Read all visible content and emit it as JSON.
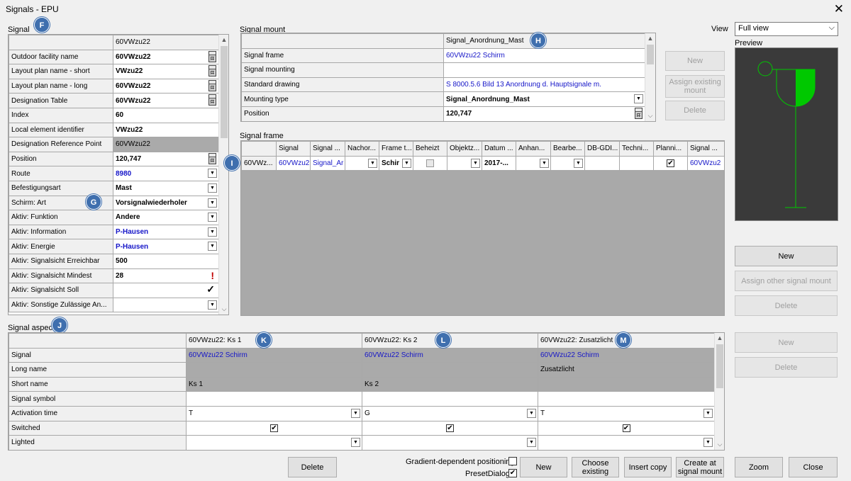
{
  "window": {
    "title": "Signals - EPU",
    "close": "✕"
  },
  "badges": {
    "F": "F",
    "G": "G",
    "H": "H",
    "I": "I",
    "J": "J",
    "K": "K",
    "L": "L",
    "M": "M"
  },
  "signal": {
    "group_label": "Signal",
    "header": "60VWzu22",
    "rows": [
      {
        "label": "Outdoor facility name",
        "value": "60VWzu22",
        "style": "bold",
        "ctrl": "calc"
      },
      {
        "label": "Layout plan name - short",
        "value": "VWzu22",
        "style": "bold",
        "ctrl": "calc"
      },
      {
        "label": "Layout plan name - long",
        "value": "60VWzu22",
        "style": "bold",
        "ctrl": "calc"
      },
      {
        "label": "Designation Table",
        "value": "60VWzu22",
        "style": "bold",
        "ctrl": "calc"
      },
      {
        "label": "Index",
        "value": "60",
        "style": "bold",
        "ctrl": ""
      },
      {
        "label": "Local element identifier",
        "value": "VWzu22",
        "style": "bold",
        "ctrl": ""
      },
      {
        "label": "Designation Reference Point",
        "value": "60VWzu22",
        "style": "gray",
        "ctrl": ""
      },
      {
        "label": "Position",
        "value": "120,747",
        "style": "bold",
        "ctrl": "calc"
      },
      {
        "label": "Route",
        "value": "8980",
        "style": "bluebold",
        "ctrl": "dd"
      },
      {
        "label": "Befestigungsart",
        "value": "Mast",
        "style": "bold",
        "ctrl": "dd"
      },
      {
        "label": "Schirm: Art",
        "value": "Vorsignalwiederholer",
        "style": "bold",
        "ctrl": "dd"
      },
      {
        "label": "Aktiv: Funktion",
        "value": "Andere",
        "style": "bold",
        "ctrl": "dd"
      },
      {
        "label": "Aktiv: Information",
        "value": "P-Hausen",
        "style": "bluebold",
        "ctrl": "dd"
      },
      {
        "label": "Aktiv: Energie",
        "value": "P-Hausen",
        "style": "bluebold",
        "ctrl": "dd"
      },
      {
        "label": "Aktiv: Signalsicht Erreichbar",
        "value": "500",
        "style": "bold",
        "ctrl": ""
      },
      {
        "label": "Aktiv: Signalsicht Mindest",
        "value": "28",
        "style": "bold",
        "ctrl": "warn"
      },
      {
        "label": "Aktiv: Signalsicht Soll",
        "value": "",
        "style": "",
        "ctrl": "pen"
      },
      {
        "label": "Aktiv: Sonstige Zulässige An...",
        "value": "",
        "style": "",
        "ctrl": "dd"
      }
    ]
  },
  "mount": {
    "group_label": "Signal mount",
    "header": "Signal_Anordnung_Mast",
    "rows": [
      {
        "label": "Signal frame",
        "value": "60VWzu22 Schirm",
        "style": "blue",
        "ctrl": ""
      },
      {
        "label": "Signal mounting",
        "value": "",
        "style": "",
        "ctrl": ""
      },
      {
        "label": "Standard drawing",
        "value": "S 8000.5.6 Bild 13 Anordnung d. Hauptsignale m.",
        "style": "blue",
        "ctrl": ""
      },
      {
        "label": "Mounting type",
        "value": "Signal_Anordnung_Mast",
        "style": "bold",
        "ctrl": "dd"
      },
      {
        "label": "Position",
        "value": "120,747",
        "style": "bold",
        "ctrl": "calc"
      }
    ],
    "buttons": {
      "new": "New",
      "assign": "Assign existing mount",
      "delete": "Delete"
    }
  },
  "view": {
    "label": "View",
    "selected": "Full view",
    "preview_label": "Preview"
  },
  "preview_colors": {
    "bg": "#3a3a3a",
    "line": "#00c800"
  },
  "frame": {
    "group_label": "Signal frame",
    "columns": [
      "",
      "Signal",
      "Signal ...",
      "Nachor...",
      "Frame t...",
      "Beheizt",
      "Objektz...",
      "Datum ...",
      "Anhan...",
      "Bearbe...",
      "DB-GDI...",
      "Techni...",
      "Planni...",
      "Signal ..."
    ],
    "row": {
      "id": "60VWz...",
      "signal": "60VWzu2",
      "signal2": "Signal_Ar",
      "frame_t": "Schir",
      "datum": "2017-...",
      "last": "60VWzu2",
      "planning_check": "✔"
    }
  },
  "right_buttons": {
    "new": "New",
    "assign_other": "Assign other signal mount",
    "delete": "Delete",
    "new2": "New",
    "delete2": "Delete"
  },
  "aspect": {
    "group_label": "Signal aspect",
    "columns": [
      "60VWzu22: Ks 1",
      "60VWzu22: Ks 2",
      "60VWzu22: Zusatzlicht"
    ],
    "labels": [
      "Signal",
      "Long name",
      "Short name",
      "Signal symbol",
      "Activation time",
      "Switched",
      "Lighted"
    ],
    "signal": [
      "60VWzu22 Schirm",
      "60VWzu22 Schirm",
      "60VWzu22 Schirm"
    ],
    "long_name": [
      "",
      "",
      "Zusatzlicht"
    ],
    "short_name": [
      "Ks 1",
      "Ks 2",
      ""
    ],
    "activation": [
      "T",
      "G",
      "T"
    ],
    "switched": "✔"
  },
  "bottom": {
    "delete": "Delete",
    "gradient": "Gradient-dependent positioning",
    "preset": "PresetDialog",
    "preset_check": "✔",
    "new": "New",
    "choose": "Choose existing",
    "insert_copy": "Insert copy",
    "create_at": "Create at signal mount",
    "zoom": "Zoom",
    "close": "Close"
  },
  "glyphs": {
    "dd": "▼",
    "up": "▲",
    "down": "▼",
    "warn": "!",
    "pen": "✓",
    "chevron": "⌵"
  }
}
